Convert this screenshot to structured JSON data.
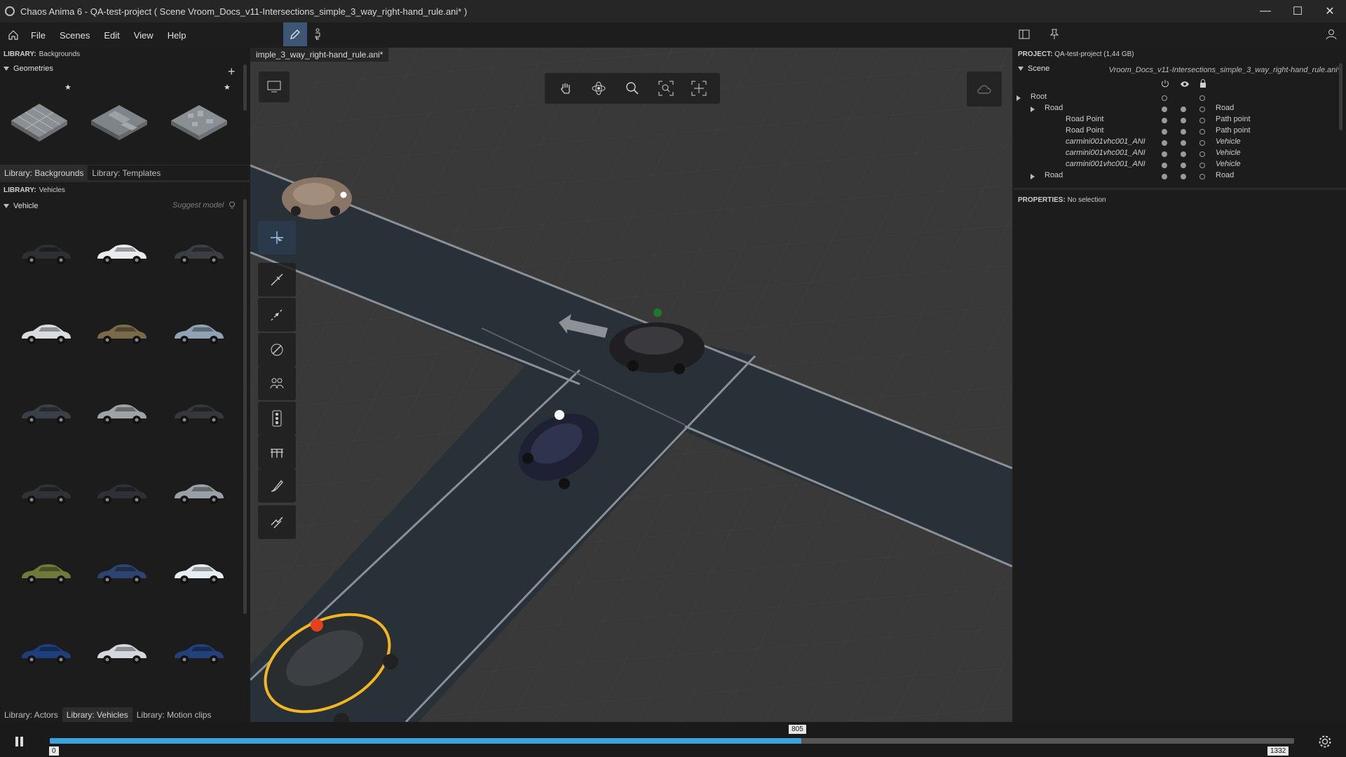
{
  "window": {
    "title": "Chaos Anima 6 -   QA-test-project ( Scene Vroom_Docs_v11-Intersections_simple_3_way_right-hand_rule.ani* )",
    "controls": [
      "minimize-icon",
      "maximize-icon",
      "close-icon"
    ]
  },
  "menu": {
    "items": [
      "File",
      "Scenes",
      "Edit",
      "View",
      "Help"
    ]
  },
  "left_panel": {
    "backgrounds_library": {
      "label": "LIBRARY:",
      "value": "Backgrounds"
    },
    "geometries_section": "Geometries",
    "top_tabs": [
      "Library: Backgrounds",
      "Library: Templates"
    ],
    "vehicles_library": {
      "label": "LIBRARY:",
      "value": "Vehicles"
    },
    "vehicle_section": "Vehicle",
    "suggest_model": "Suggest model",
    "bottom_tabs": [
      "Library: Actors",
      "Library: Vehicles",
      "Library: Motion clips"
    ],
    "vehicle_colors": [
      "#2c2f33",
      "#e8ecef",
      "#3b3e42",
      "#d9dde0",
      "#7a6a4a",
      "#8fa3b5",
      "#3a4048",
      "#9ea3a8",
      "#34373b",
      "#2f3338",
      "#2e3135",
      "#9aa0a6",
      "#6f7a3a",
      "#2e4470",
      "#e6eef3",
      "#1f3f7a",
      "#d4d8dc",
      "#24407a"
    ]
  },
  "viewport": {
    "doc_tab": "imple_3_way_right-hand_rule.ani*"
  },
  "right_panel": {
    "project_label": "PROJECT:",
    "project_value": "QA-test-project (1,44 GB)",
    "scene_label": "Scene",
    "scene_file": "Vroom_Docs_v11-Intersections_simple_3_way_right-hand_rule.ani*",
    "tree": [
      {
        "name": "Root",
        "type": ""
      },
      {
        "name": "Road",
        "type": "Road"
      },
      {
        "name": "Road Point",
        "type": "Path point"
      },
      {
        "name": "Road Point",
        "type": "Path point"
      },
      {
        "name": "carmini001vhc001_ANI",
        "type": "Vehicle"
      },
      {
        "name": "carmini001vhc001_ANI",
        "type": "Vehicle"
      },
      {
        "name": "carmini001vhc001_ANI",
        "type": "Vehicle"
      },
      {
        "name": "Road",
        "type": "Road"
      }
    ],
    "properties_label": "PROPERTIES:",
    "properties_value": "No selection"
  },
  "timeline": {
    "start": "0",
    "current": "805",
    "end": "1332",
    "progress": 0.604
  }
}
